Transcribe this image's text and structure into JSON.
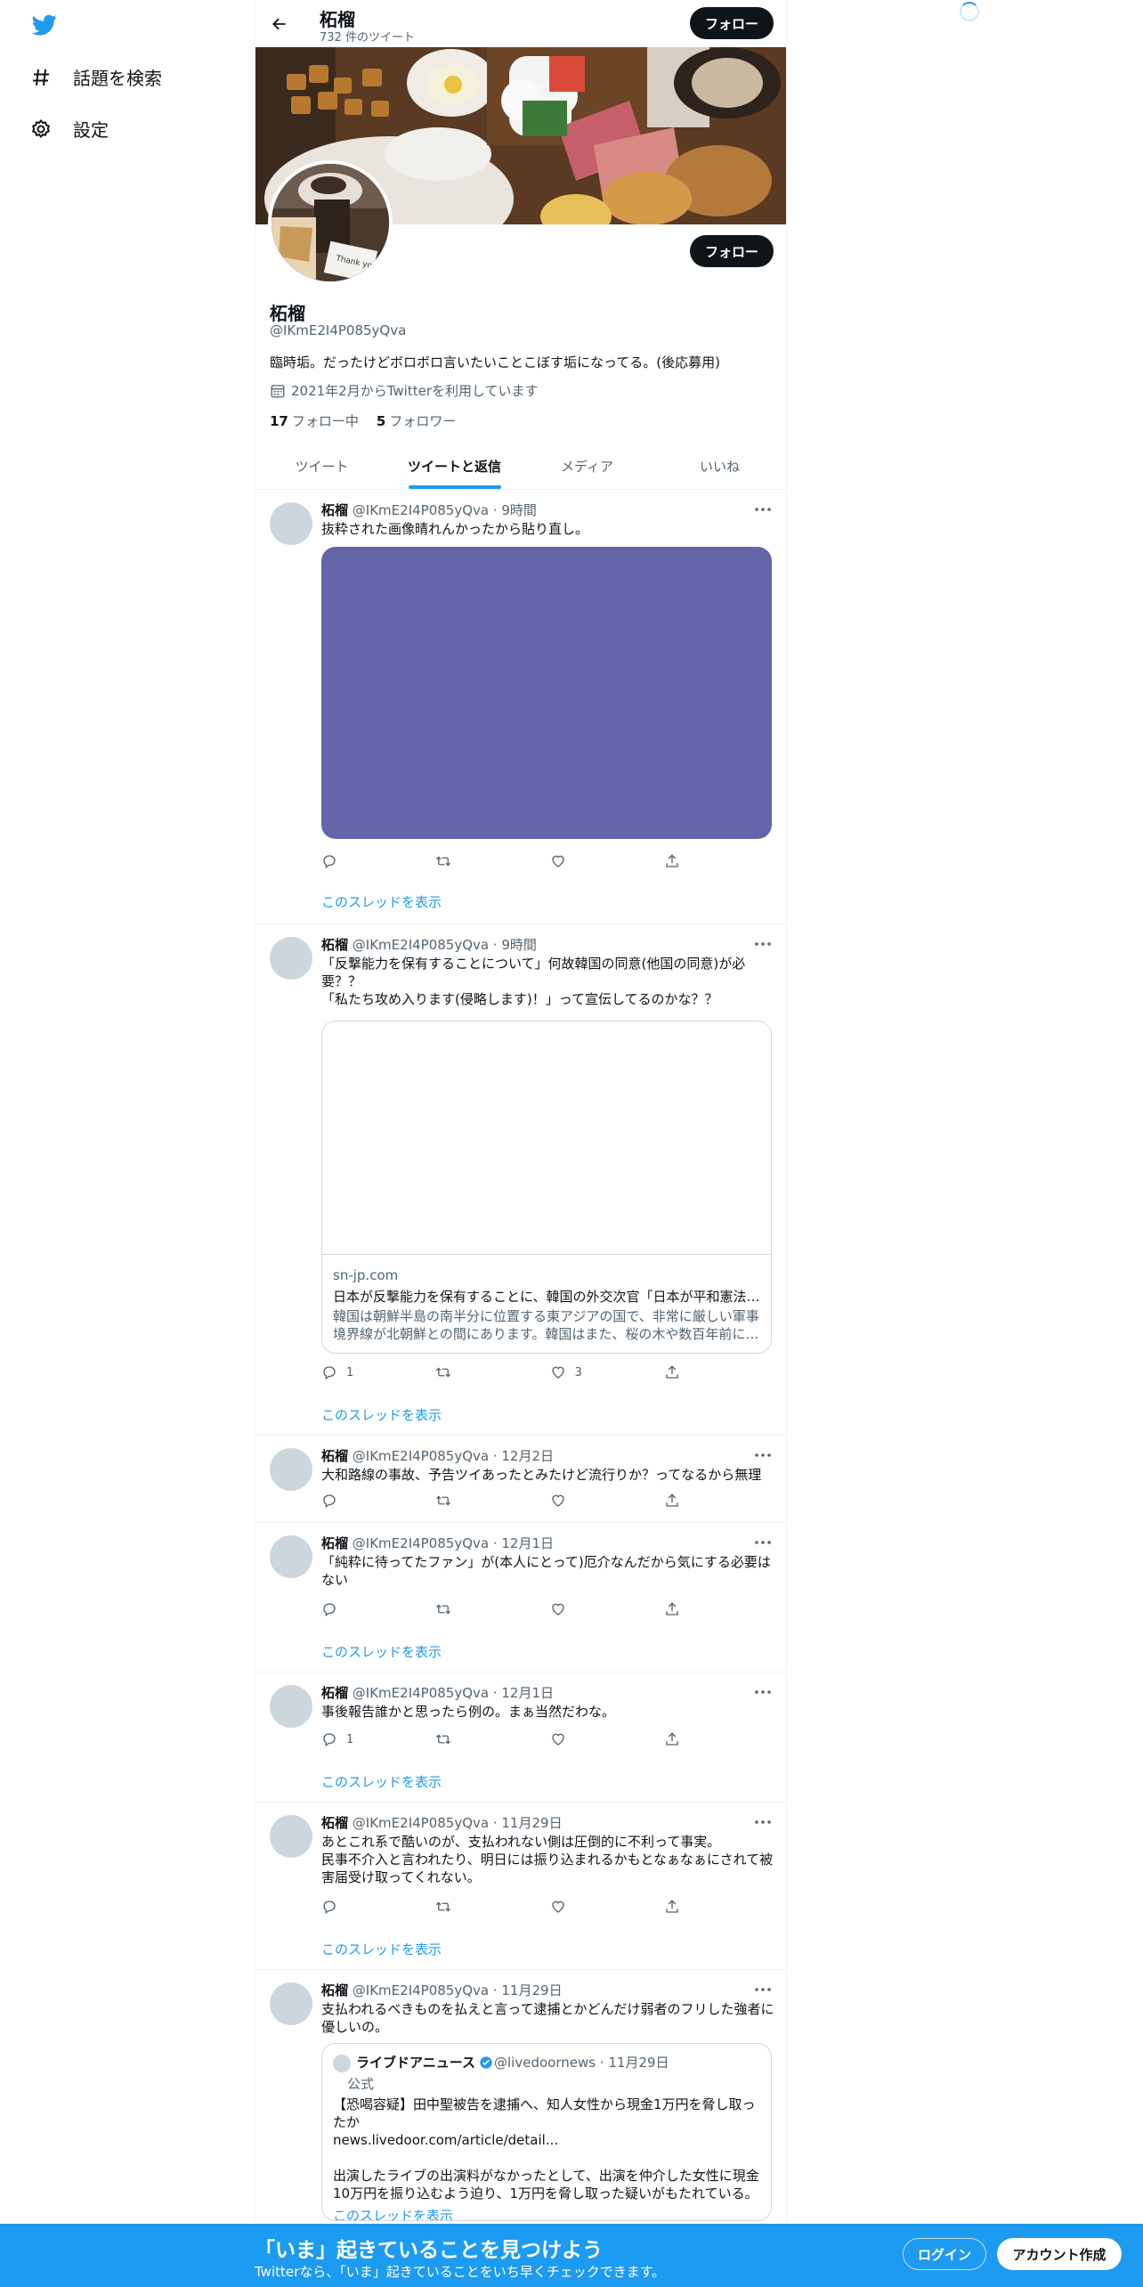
{
  "sidebar": {
    "items": [
      {
        "label": "話題を検索",
        "icon": "hashtag-icon"
      },
      {
        "label": "設定",
        "icon": "gear-icon"
      }
    ]
  },
  "header": {
    "title": "柘榴",
    "tweet_count": "732 件のツイート",
    "follow_label": "フォロー"
  },
  "profile": {
    "name": "柘榴",
    "handle": "@IKmE2I4P085yQva",
    "bio": "臨時垢。だったけどボロボロ言いたいことこぼす垢になってる。(後応募用)",
    "joined": "2021年2月からTwitterを利用しています",
    "following_count": "17",
    "following_label": "フォロー中",
    "followers_count": "5",
    "followers_label": "フォロワー",
    "follow_label": "フォロー"
  },
  "tabs": [
    {
      "label": "ツイート"
    },
    {
      "label": "ツイートと返信"
    },
    {
      "label": "メディア"
    },
    {
      "label": "いいね"
    }
  ],
  "thread_label": "このスレッドを表示",
  "tweets": [
    {
      "name": "柘榴",
      "meta": "@IKmE2I4P085yQva · 9時間",
      "text": "抜粋された画像晴れんかったから貼り直し。",
      "reply_count": "",
      "like_count": "",
      "media_color": "#6464a8"
    },
    {
      "name": "柘榴",
      "meta": "@IKmE2I4P085yQva · 9時間",
      "text": "「反撃能力を保有することについて」何故韓国の同意(他国の同意)が必要？？\n「私たち攻め入ります(侵略します)！」って宣伝してるのかな？？",
      "reply_count": "1",
      "like_count": "3",
      "card": {
        "domain": "sn-jp.com",
        "title": "日本が反撃能力を保有することに、韓国の外交次官「日本が平和憲法…",
        "desc": "韓国は朝鮮半島の南半分に位置する東アジアの国で、非常に厳しい軍事境界線が北朝鮮との間にあります。韓国はまた、桜の木や数百年前に…"
      }
    },
    {
      "name": "柘榴",
      "meta": "@IKmE2I4P085yQva · 12月2日",
      "text": "大和路線の事故、予告ツイあったとみたけど流行りか？ってなるから無理"
    },
    {
      "name": "柘榴",
      "meta": "@IKmE2I4P085yQva · 12月1日",
      "text": "「純粋に待ってたファン」が(本人にとって)厄介なんだから気にする必要はない"
    },
    {
      "name": "柘榴",
      "meta": "@IKmE2I4P085yQva · 12月1日",
      "text": "事後報告誰かと思ったら例の。まぁ当然だわな。",
      "reply_count": "1"
    },
    {
      "name": "柘榴",
      "meta": "@IKmE2I4P085yQva · 11月29日",
      "text": "あとこれ系で酷いのが、支払われない側は圧倒的に不利って事実。\n民事不介入と言われたり、明日には振り込まれるかもとなぁなぁにされて被害届受け取ってくれない。"
    },
    {
      "name": "柘榴",
      "meta": "@IKmE2I4P085yQva · 11月29日",
      "text": "支払われるべきものを払えと言って逮捕とかどんだけ弱者のフリした強者に優しいの。",
      "quote": {
        "name": "ライブドアニュース",
        "meta": "@livedoornews · 11月29日",
        "label": "公式",
        "text": "【恐喝容疑】田中聖被告を逮捕へ、知人女性から現金1万円を脅し取ったか\nnews.livedoor.com/article/detail...\n\n出演したライブの出演料がなかったとして、出演を仲介した女性に現金10万円を振り込むよう迫り、1万円を脅し取った疑いがもたれている。"
      }
    }
  ],
  "bottom_bar": {
    "title": "「いま」起きていることを見つけよう",
    "subtitle": "Twitterなら、「いま」起きていることをいち早くチェックできます。",
    "login_label": "ログイン",
    "signup_label": "アカウント作成"
  },
  "colors": {
    "accent": "#1d9bf0",
    "text": "#0f1419",
    "muted": "#536471"
  }
}
